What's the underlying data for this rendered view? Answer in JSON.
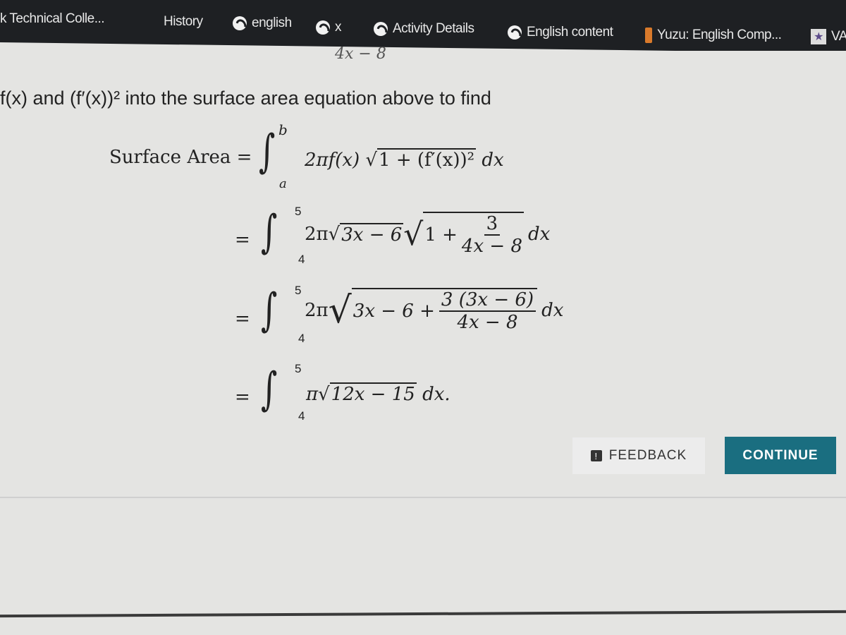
{
  "bookmarks": [
    {
      "label": "k Technical Colle...",
      "icon": "none"
    },
    {
      "label": "History",
      "icon": "none"
    },
    {
      "label": "english",
      "icon": "globe-icon"
    },
    {
      "label": "x",
      "icon": "globe-icon"
    },
    {
      "label": "Activity Details",
      "icon": "globe-icon"
    },
    {
      "label": "English content",
      "icon": "globe-icon"
    },
    {
      "label": "Yuzu: English Comp...",
      "icon": "yuzu-icon"
    },
    {
      "label": "VA",
      "icon": "star-icon"
    }
  ],
  "content": {
    "top_partial": "4x − 8",
    "intro": "f(x) and (f′(x))² into the surface area equation above to find",
    "line1": {
      "label": "Surface Area =",
      "upper": "b",
      "lower": "a",
      "coef": "2πf(x)",
      "radicand": "1 + (f′(x))²",
      "dx": "dx"
    },
    "line2": {
      "eq": "=",
      "upper": "5",
      "lower": "4",
      "coef": "2π",
      "radicand1": "3x − 6",
      "radicand2_prefix": "1 +",
      "num": "3",
      "den": "4x − 8",
      "dx": "dx"
    },
    "line3": {
      "eq": "=",
      "upper": "5",
      "lower": "4",
      "coef": "2π",
      "radicand_prefix": "3x − 6 +",
      "num": "3 (3x − 6)",
      "den": "4x − 8",
      "dx": "dx"
    },
    "line4": {
      "eq": "=",
      "upper": "5",
      "lower": "4",
      "coef": "π",
      "radicand": "12x − 15",
      "dx": "dx."
    }
  },
  "buttons": {
    "feedback": "FEEDBACK",
    "feedback_icon": "!",
    "continue": "CONTINUE"
  },
  "colors": {
    "bar": "#1e2023",
    "continue": "#1a6e80"
  }
}
